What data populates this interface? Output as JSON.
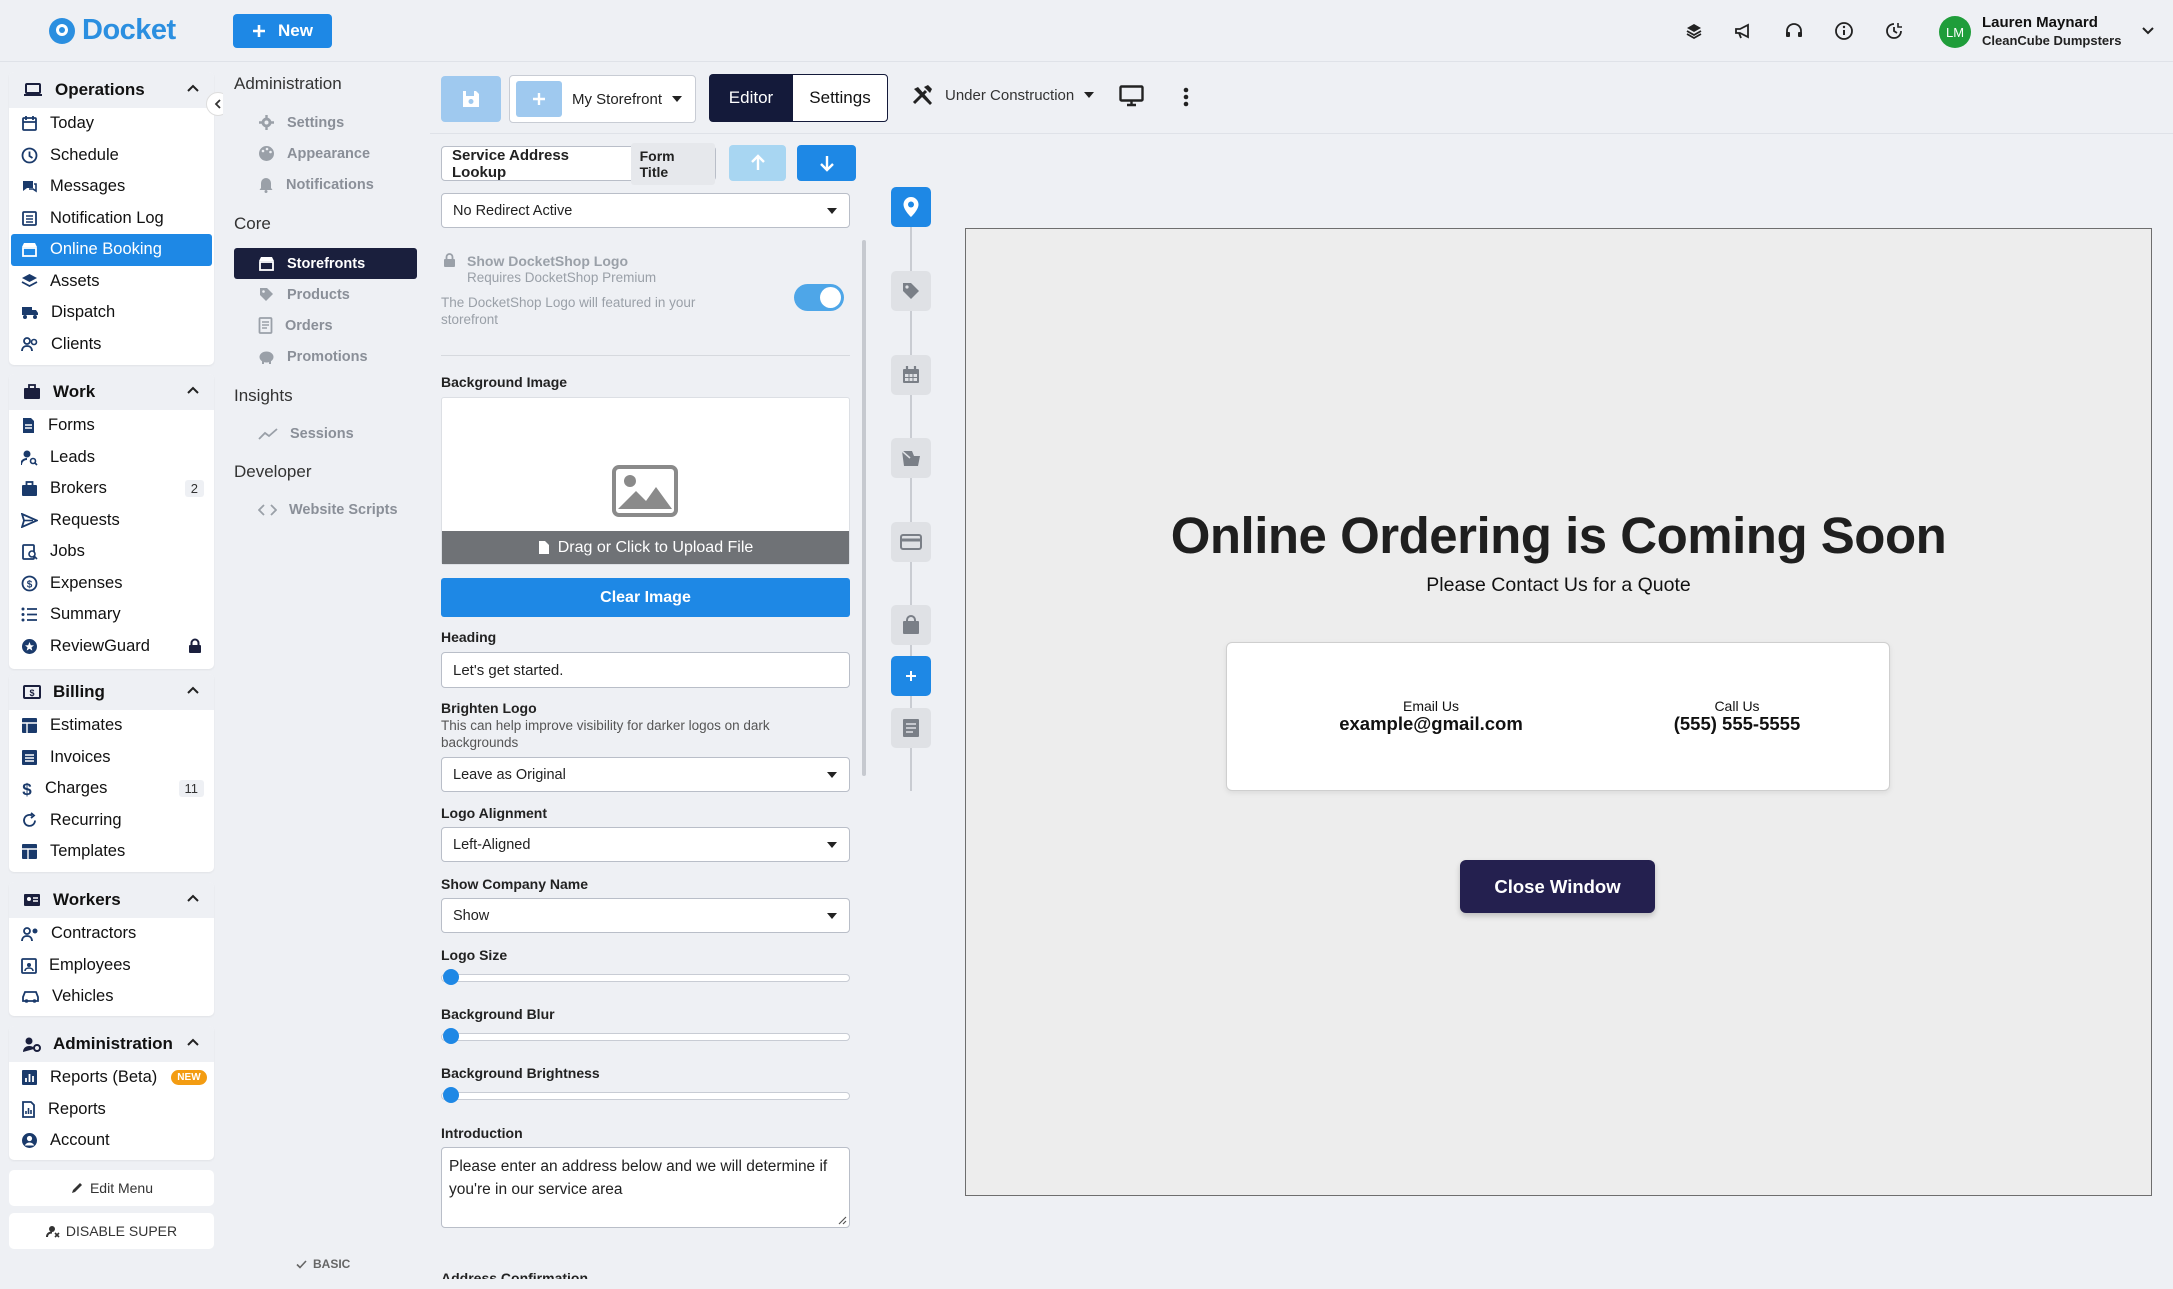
{
  "app": {
    "brand": "Docket",
    "new_label": "New"
  },
  "user": {
    "initials": "LM",
    "name": "Lauren Maynard",
    "company": "CleanCube Dumpsters"
  },
  "nav": {
    "operations": {
      "title": "Operations",
      "items": [
        "Today",
        "Schedule",
        "Messages",
        "Notification Log",
        "Online Booking",
        "Assets",
        "Dispatch",
        "Clients"
      ]
    },
    "work": {
      "title": "Work",
      "items": [
        "Forms",
        "Leads",
        "Brokers",
        "Requests",
        "Jobs",
        "Expenses",
        "Summary",
        "ReviewGuard"
      ],
      "brokers_badge": "2"
    },
    "billing": {
      "title": "Billing",
      "items": [
        "Estimates",
        "Invoices",
        "Charges",
        "Recurring",
        "Templates"
      ],
      "charges_badge": "11"
    },
    "workers": {
      "title": "Workers",
      "items": [
        "Contractors",
        "Employees",
        "Vehicles"
      ]
    },
    "administration": {
      "title": "Administration",
      "items": [
        "Reports (Beta)",
        "Reports",
        "Account"
      ],
      "new_badge": "NEW"
    },
    "edit_menu": "Edit Menu",
    "disable_super": "DISABLE SUPER"
  },
  "subnav": {
    "administration": {
      "title": "Administration",
      "items": [
        "Settings",
        "Appearance",
        "Notifications"
      ]
    },
    "core": {
      "title": "Core",
      "items": [
        "Storefronts",
        "Products",
        "Orders",
        "Promotions"
      ]
    },
    "insights": {
      "title": "Insights",
      "items": [
        "Sessions"
      ]
    },
    "developer": {
      "title": "Developer",
      "items": [
        "Website Scripts"
      ]
    },
    "plan": "BASIC"
  },
  "toolbar": {
    "storefront": "My Storefront",
    "tab_editor": "Editor",
    "tab_settings": "Settings",
    "status": "Under Construction"
  },
  "form": {
    "title_value": "Service Address Lookup",
    "title_tag": "Form Title",
    "redirect": "No Redirect Active",
    "docketshop_title": "Show DocketShop Logo",
    "docketshop_req": "Requires DocketShop Premium",
    "docketshop_desc": "The DocketShop Logo will featured in your storefront",
    "bg_image_label": "Background Image",
    "upload_label": "Drag or Click to Upload File",
    "clear_image": "Clear Image",
    "heading_label": "Heading",
    "heading_value": "Let's get started.",
    "brighten_label": "Brighten Logo",
    "brighten_desc": "This can help improve visibility for darker logos on dark backgrounds",
    "brighten_value": "Leave as Original",
    "alignment_label": "Logo Alignment",
    "alignment_value": "Left-Aligned",
    "company_label": "Show Company Name",
    "company_value": "Show",
    "logo_size_label": "Logo Size",
    "logo_size": 0,
    "blur_label": "Background Blur",
    "blur": 0,
    "brightness_label": "Background Brightness",
    "brightness": 0,
    "intro_label": "Introduction",
    "intro_value": "Please enter an address below and we will determine if you're in our service area",
    "address_label": "Address Confirmation"
  },
  "preview": {
    "heading": "Online Ordering is Coming Soon",
    "subheading": "Please Contact Us for a Quote",
    "email_label": "Email Us",
    "email_value": "example@gmail.com",
    "phone_label": "Call Us",
    "phone_value": "(555) 555-5555",
    "close_label": "Close Window"
  },
  "colors": {
    "accent": "#1e88e5",
    "navy": "#141a3a",
    "close_button": "#24204f"
  }
}
